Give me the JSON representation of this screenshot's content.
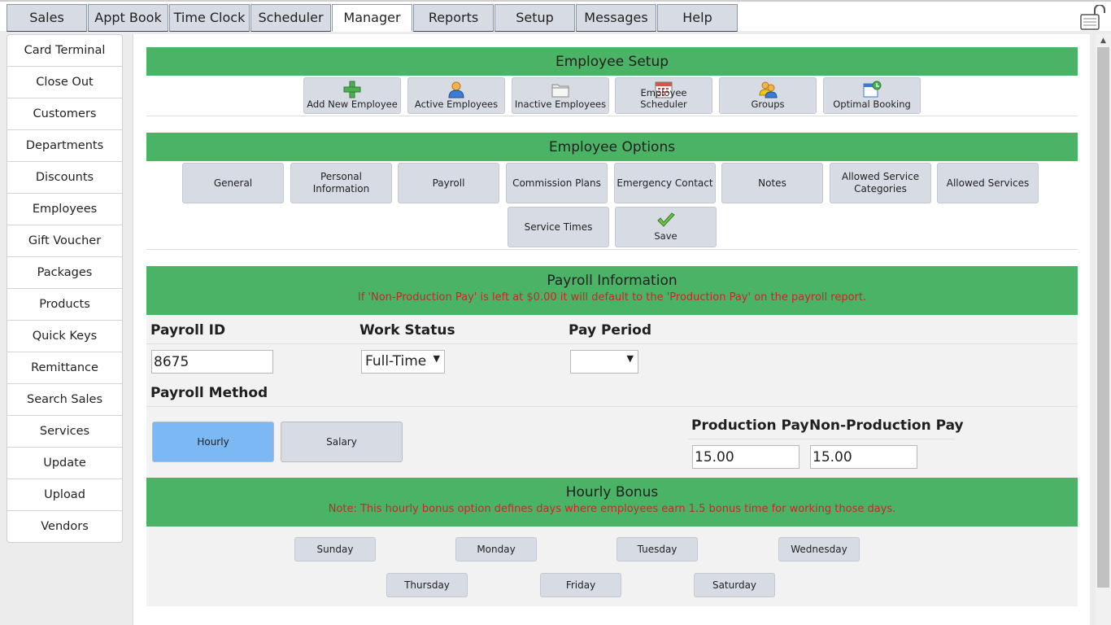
{
  "top_tabs": [
    {
      "label": "Sales"
    },
    {
      "label": "Appt Book"
    },
    {
      "label": "Time Clock"
    },
    {
      "label": "Scheduler"
    },
    {
      "label": "Manager"
    },
    {
      "label": "Reports"
    },
    {
      "label": "Setup"
    },
    {
      "label": "Messages"
    },
    {
      "label": "Help"
    }
  ],
  "active_tab": "Manager",
  "sidebar": {
    "items": [
      {
        "label": "Card Terminal"
      },
      {
        "label": "Close Out"
      },
      {
        "label": "Customers"
      },
      {
        "label": "Departments"
      },
      {
        "label": "Discounts"
      },
      {
        "label": "Employees"
      },
      {
        "label": "Gift Voucher"
      },
      {
        "label": "Packages"
      },
      {
        "label": "Products"
      },
      {
        "label": "Quick Keys"
      },
      {
        "label": "Remittance"
      },
      {
        "label": "Search Sales"
      },
      {
        "label": "Services"
      },
      {
        "label": "Update"
      },
      {
        "label": "Upload"
      },
      {
        "label": "Vendors"
      }
    ]
  },
  "employee_setup": {
    "title": "Employee Setup",
    "buttons": [
      {
        "label": "Add New Employee",
        "icon": "add-plus-icon"
      },
      {
        "label": "Active Employees",
        "icon": "person-icon"
      },
      {
        "label": "Inactive Employees",
        "icon": "folder-icon"
      },
      {
        "label": "Employee Scheduler",
        "icon": "calendar-icon"
      },
      {
        "label": "Groups",
        "icon": "group-icon"
      },
      {
        "label": "Optimal Booking",
        "icon": "booking-icon"
      }
    ]
  },
  "employee_options": {
    "title": "Employee Options",
    "buttons": [
      {
        "label": "General"
      },
      {
        "label": "Personal Information"
      },
      {
        "label": "Payroll"
      },
      {
        "label": "Commission Plans"
      },
      {
        "label": "Emergency Contact"
      },
      {
        "label": "Notes"
      },
      {
        "label": "Allowed Service Categories"
      },
      {
        "label": "Allowed Services"
      },
      {
        "label": "Service Times"
      },
      {
        "label": "Save"
      }
    ]
  },
  "payroll": {
    "title": "Payroll Information",
    "note": "If 'Non-Production Pay' is left at $0.00 it will default to the 'Production Pay' on the payroll report.",
    "payroll_id_label": "Payroll ID",
    "payroll_id_value": "8675",
    "work_status_label": "Work Status",
    "work_status_value": "Full-Time",
    "pay_period_label": "Pay Period",
    "pay_period_value": "",
    "method_label": "Payroll Method",
    "method_hourly": "Hourly",
    "method_salary": "Salary",
    "selected_method": "Hourly",
    "production_pay_label": "Production Pay",
    "production_pay_value": "15.00",
    "non_production_pay_label": "Non-Production Pay",
    "non_production_pay_value": "15.00"
  },
  "hourly_bonus": {
    "title": "Hourly Bonus",
    "note": "Note: This hourly bonus option defines days where employees earn 1.5 bonus time for working those days.",
    "days": [
      "Sunday",
      "Monday",
      "Tuesday",
      "Wednesday",
      "Thursday",
      "Friday",
      "Saturday"
    ]
  },
  "colors": {
    "header_green": "#4bb366",
    "note_red": "#c62828",
    "selected_blue": "#7cb8f4",
    "button_gray": "#d7dbe3"
  }
}
